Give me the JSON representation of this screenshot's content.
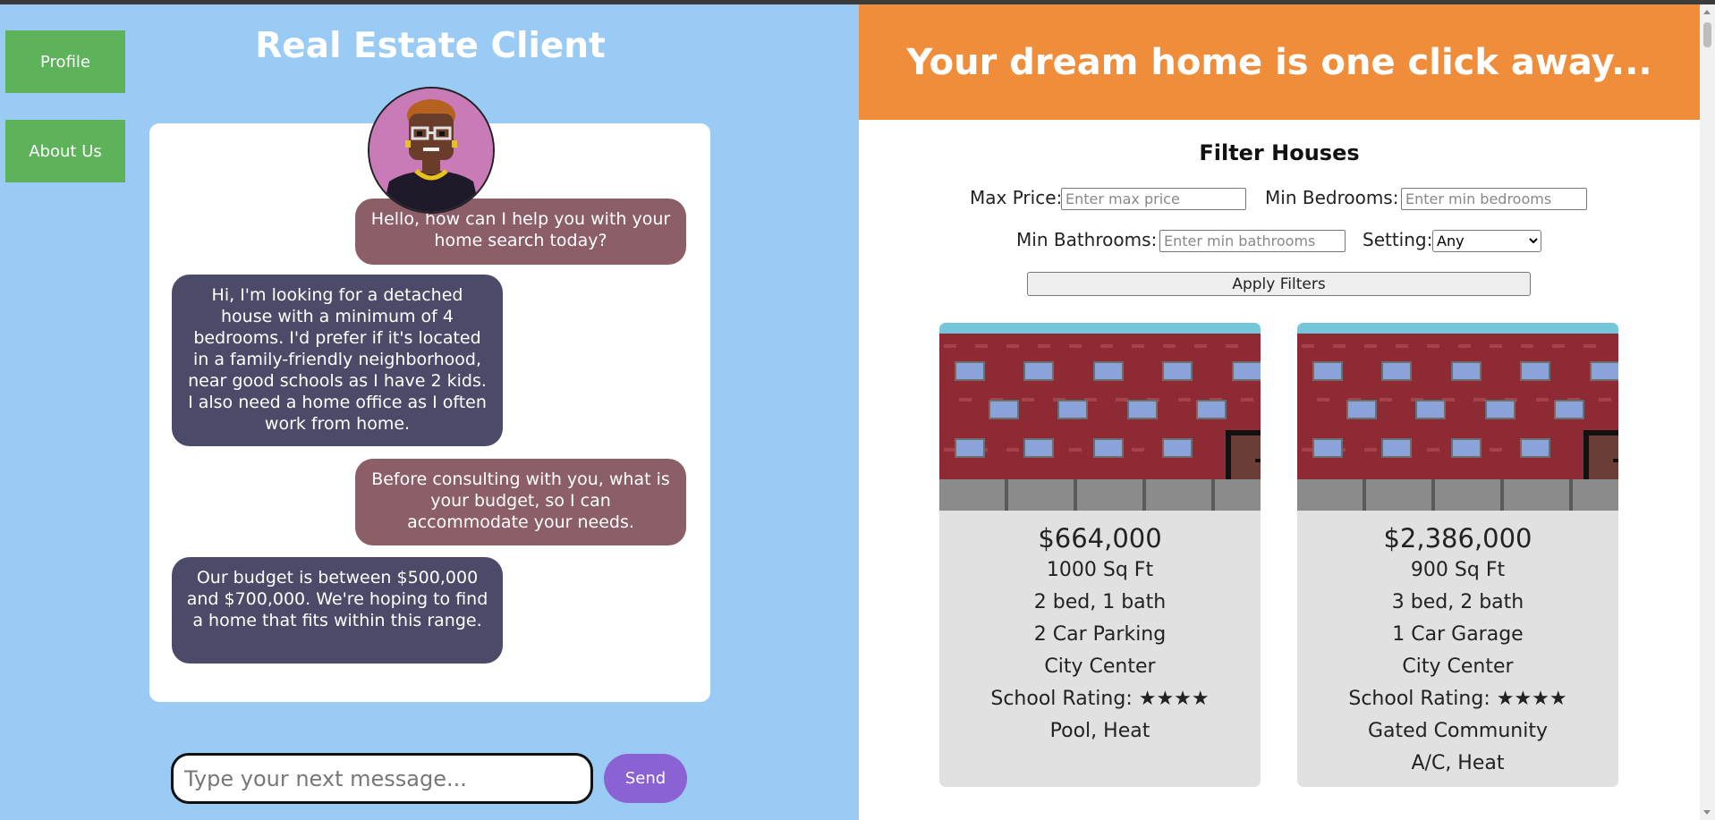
{
  "nav": {
    "profile_label": "Profile",
    "about_label": "About Us"
  },
  "app": {
    "title": "Real Estate Client"
  },
  "chat": {
    "messages": [
      {
        "role": "agent",
        "text": "Hello, how can I help you with your home search today?"
      },
      {
        "role": "client",
        "text": "Hi, I'm looking for a detached house with a minimum of 4 bedrooms. I'd prefer if it's located in a family-friendly neighborhood, near good schools as I have 2 kids. I also need a home office as I often work from home."
      },
      {
        "role": "agent",
        "text": "Before consulting with you, what is your budget, so I can accommodate your needs."
      },
      {
        "role": "client",
        "text": "Our budget is between $500,000 and $700,000. We're hoping to find a home that fits within this range."
      }
    ],
    "input_placeholder": "Type your next message...",
    "send_label": "Send"
  },
  "hero": {
    "text": "Your dream home is one click away..."
  },
  "filters": {
    "title": "Filter Houses",
    "max_price_label": "Max Price:",
    "max_price_placeholder": "Enter max price",
    "min_bedrooms_label": "Min Bedrooms:",
    "min_bedrooms_placeholder": "Enter min bedrooms",
    "min_bathrooms_label": "Min Bathrooms:",
    "min_bathrooms_placeholder": "Enter min bathrooms",
    "setting_label": "Setting:",
    "setting_value": "Any",
    "apply_label": "Apply Filters"
  },
  "listings": [
    {
      "price": "$664,000",
      "sqft": "1000 Sq Ft",
      "beds_baths": "2 bed, 1 bath",
      "parking": "2 Car Parking",
      "location": "City Center",
      "school": "School Rating: ★★★★",
      "features": [
        "Pool, Heat"
      ]
    },
    {
      "price": "$2,386,000",
      "sqft": "900 Sq Ft",
      "beds_baths": "3 bed, 2 bath",
      "parking": "1 Car Garage",
      "location": "City Center",
      "school": "School Rating: ★★★★",
      "features": [
        "Gated Community",
        "A/C, Heat"
      ]
    }
  ],
  "colors": {
    "left_bg": "#99cbf5",
    "nav_green": "#5eb25a",
    "agent_bubble": "#8b5e68",
    "client_bubble": "#4b4a69",
    "send_purple": "#8b62d4",
    "hero_orange": "#ef8d3a",
    "card_bg": "#e1e1e1",
    "brick": "#8e2a33",
    "window_blue": "#8aa3d8"
  }
}
